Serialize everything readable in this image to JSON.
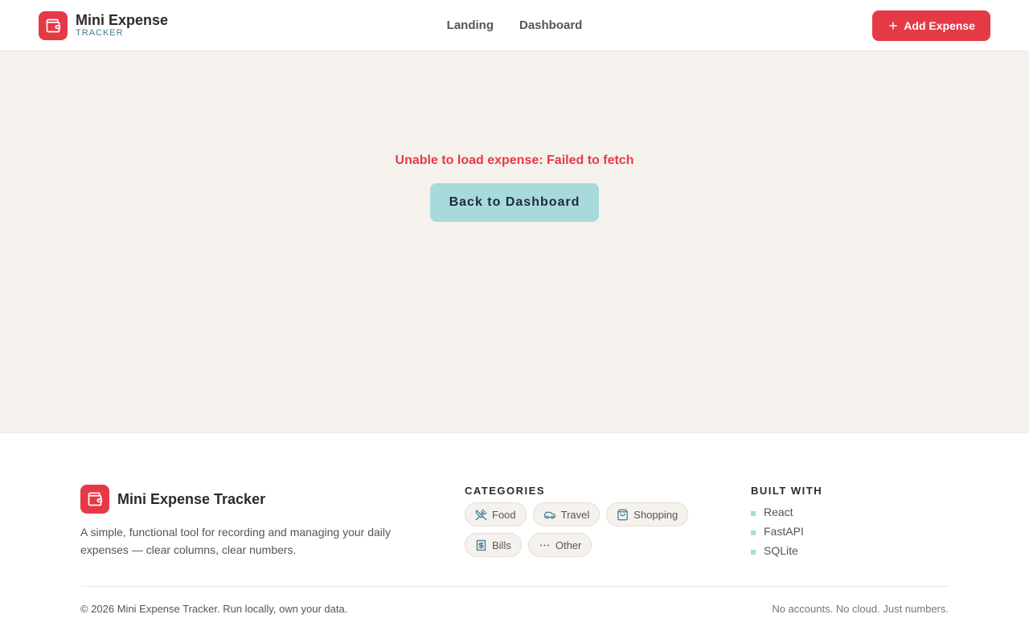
{
  "header": {
    "brand_title": "Mini Expense",
    "brand_sub": "TRACKER",
    "nav": [
      {
        "label": "Landing"
      },
      {
        "label": "Dashboard"
      }
    ],
    "add_label": "Add Expense"
  },
  "main": {
    "error_text": "Unable to load expense: Failed to fetch",
    "back_label": "Back to Dashboard"
  },
  "footer": {
    "brand_title": "Mini Expense Tracker",
    "description": "A simple, functional tool for recording and managing your daily expenses — clear columns, clear numbers.",
    "categories_heading": "CATEGORIES",
    "categories": [
      {
        "label": "Food",
        "icon": "utensils-crossed-icon"
      },
      {
        "label": "Travel",
        "icon": "car-icon"
      },
      {
        "label": "Shopping",
        "icon": "shopping-bag-icon"
      },
      {
        "label": "Bills",
        "icon": "receipt-icon"
      },
      {
        "label": "Other",
        "icon": "ellipsis-icon"
      }
    ],
    "built_heading": "BUILT WITH",
    "built": [
      "React",
      "FastAPI",
      "SQLite"
    ],
    "copyright": "© 2026 Mini Expense Tracker. Run locally, own your data.",
    "tagline": "No accounts. No cloud. Just numbers."
  },
  "colors": {
    "accent": "#e63946",
    "secondary": "#a8dadc",
    "teal_text": "#3d7d8f",
    "main_bg": "#f5f2ee"
  }
}
